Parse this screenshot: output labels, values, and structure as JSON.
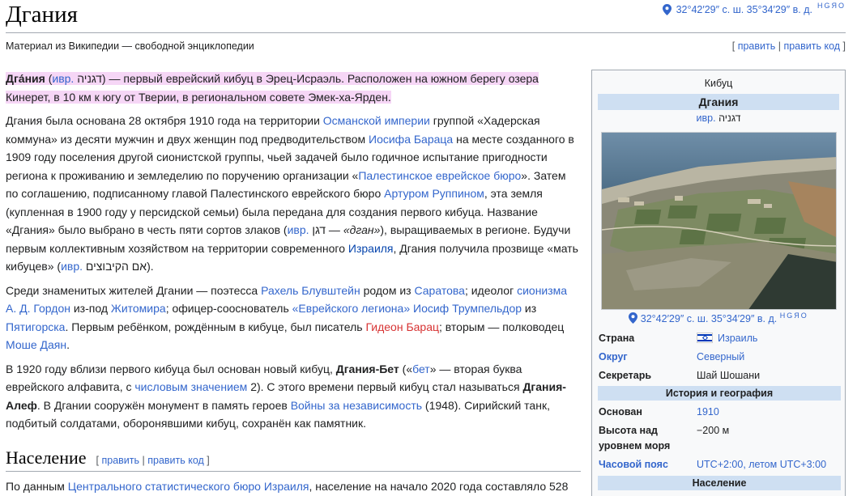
{
  "page": {
    "title": "Дгания",
    "coords": "32°42′29″ с. ш. 35°34′29″ в. д.",
    "coords_sup": "HGЯO",
    "tagline": "Материал из Википедии — свободной энциклопедии",
    "edit": {
      "open": "[ ",
      "edit": "править",
      "sep": " | ",
      "edit_code": "править код",
      "close": " ]"
    }
  },
  "intro": {
    "name": "Дга́ния",
    "pre_lang": " (",
    "lang": "ивр.",
    "hebrew": " דגניה",
    "rest": ") — первый еврейский кибуц в Эрец-Исраэль. Расположен на южном берегу озера Кинерет, в 10 км к югу от Тверии, в региональном совете Эмек-ха-Ярден."
  },
  "p2": {
    "t1": "Дгания была основана 28 октября 1910 года на территории ",
    "l1": "Османской империи",
    "t2": " группой «Хадерская коммуна» из десяти мужчин и двух женщин под предводительством ",
    "l2": "Иосифа Бараца",
    "t3": " на месте созданного в 1909 году поселения другой сионистской группы, чьей задачей было годичное испытание пригодности региона к проживанию и земледелию по поручению организации «",
    "l3": "Палестинское еврейское бюро",
    "t4": "». Затем по соглашению, подписанному главой Палестинского еврейского бюро ",
    "l4": "Артуром Руппином",
    "t5": ", эта земля (купленная в 1900 году у персидской семьи) была передана для создания первого кибуца. Название «Дгания» было выбрано в честь пяти сортов злаков (",
    "l5": "ивр.",
    "t6": " דגן — ",
    "i6": "«дган»",
    "t7": "), выращиваемых в регионе. Будучи первым коллективным хозяйством на территории современного ",
    "l7": "Израиля",
    "t8": ", Дгания получила прозвище «мать кибуцев» (",
    "l8": "ивр.",
    "t9": " אם הקיבוצים",
    "t10": ")."
  },
  "p3": {
    "t1": "Среди знаменитых жителей Дгании — поэтесса ",
    "l1": "Рахель Блувштейн",
    "t2": " родом из ",
    "l2": "Саратова",
    "t3": "; идеолог ",
    "l3": "сионизма",
    "t3b": " ",
    "l4": "А. Д. Гордон",
    "t4": " из-под ",
    "l5": "Житомира",
    "t5": "; офицер-сооснователь ",
    "l6": "«Еврейского легиона»",
    "t6": " ",
    "l7": "Иосиф Трумпельдор",
    "t7": " из ",
    "l8": "Пятигорска",
    "t8": ". Первым ребёнком, рождённым в кибуце, был писатель ",
    "l9": "Гидеон Барац",
    "t9": "; вторым — полководец ",
    "l10": "Моше Даян",
    "t10": "."
  },
  "p4": {
    "t1": "В 1920 году вблизи первого кибуца был основан новый кибуц, ",
    "b1": "Дгания-Бет",
    "t2": " («",
    "l1": "бет",
    "t3": "» — вторая буква еврейского алфавита, с ",
    "l2": "числовым значением",
    "t4": " 2). С этого времени первый кибуц стал называться ",
    "b2": "Дгания-Алеф",
    "t5": ". В Дгании сооружён монумент в память героев ",
    "l3": "Войны за независимость",
    "t6": " (1948). Сирийский танк, подбитый солдатами, оборонявшими кибуц, сохранён как памятник."
  },
  "section": {
    "title": "Население",
    "edit_open": "[ ",
    "edit": "править",
    "sep": " | ",
    "edit_code": "править код",
    "edit_close": " ]",
    "t1": "По данным ",
    "l1": "Центрального статистического бюро Израиля",
    "t2": ", население на начало 2020 года составляло 528"
  },
  "infobox": {
    "type": "Кибуц",
    "name": "Дгания",
    "lang": "ивр.",
    "hebrew": " דגניה",
    "coords": "32°42′29″ с. ш. 35°34′29″ в. д.",
    "coords_sup": "HGЯO",
    "rows": [
      {
        "k": "Страна",
        "v": "Израиль"
      },
      {
        "k": "Округ",
        "v": "Северный"
      },
      {
        "k": "Секретарь",
        "v": "Шай Шошани"
      }
    ],
    "sec1": "История и география",
    "rows2": [
      {
        "k": "Основан",
        "v": "1910"
      },
      {
        "k": "Высота над уровнем моря",
        "v": "−200 м"
      },
      {
        "k": "Часовой пояс",
        "v": "UTC+2:00, летом UTC+3:00"
      }
    ],
    "sec2": "Население"
  },
  "colors": {
    "link": "#3366cc",
    "redlink": "#d73333",
    "infobox_header": "#cedff2",
    "highlight": "#f6d6f6"
  }
}
